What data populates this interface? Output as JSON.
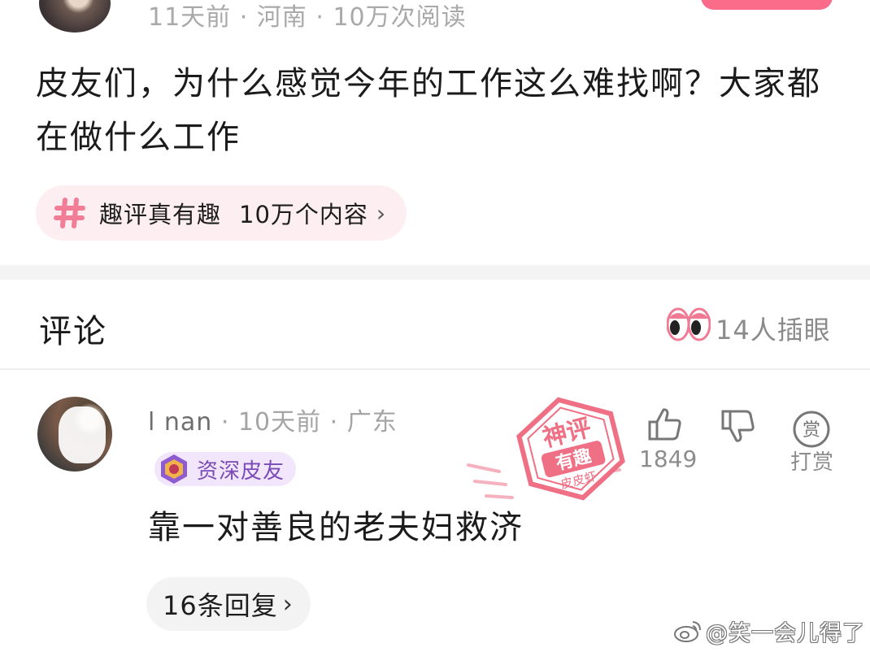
{
  "post": {
    "time": "11天前",
    "location": "河南",
    "reads": "10万次阅读",
    "title": "皮友们，为什么感觉今年的工作这么难找啊？大家都在做什么工作",
    "topic": {
      "name": "趣评真有趣",
      "count": "10万个内容",
      "chevron": "›"
    }
  },
  "comments_header": {
    "title": "评论",
    "peek": "14人插眼"
  },
  "comment": {
    "user_name": "l         nan",
    "time": "10天前",
    "location": "广东",
    "badge": "资深皮友",
    "text": "靠一对善良的老夫妇救济",
    "replies": "16条回复",
    "replies_chevron": "›",
    "likes": "1849",
    "reward_icon_char": "赏",
    "reward_label": "打赏"
  },
  "stamp": {
    "top": "神评",
    "mid": "有趣",
    "bottom": "皮皮虾"
  },
  "watermark": {
    "text": "@笑一会儿得了"
  },
  "colors": {
    "accent_pink": "#fb6b8a",
    "topic_bg": "#fdeef1",
    "badge_bg": "#f1e6fb",
    "badge_text": "#7a4ab6",
    "stamp": "#ef6f84"
  },
  "icons": [
    "hashtag-icon",
    "eyes-icon",
    "thumb-up-icon",
    "thumb-down-icon",
    "reward-icon",
    "badge-icon",
    "weibo-icon"
  ]
}
